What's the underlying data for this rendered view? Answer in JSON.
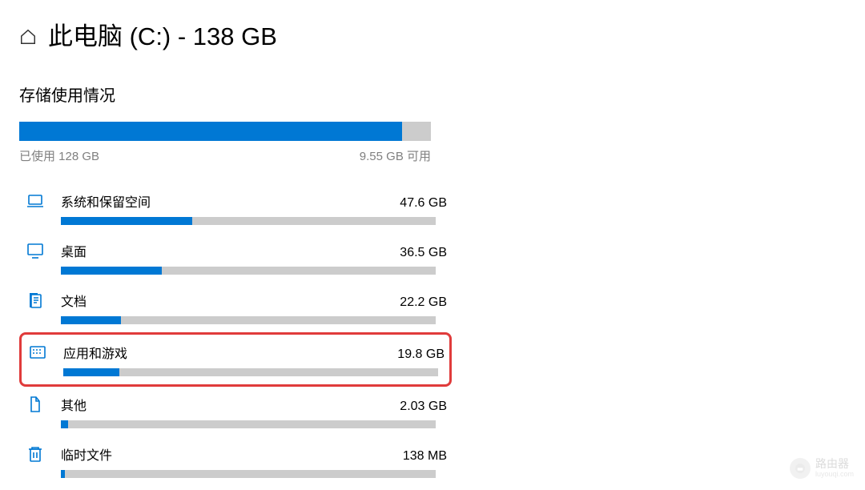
{
  "header": {
    "title": "此电脑 (C:) - 138 GB"
  },
  "section_title": "存储使用情况",
  "overview": {
    "used_label": "已使用 128 GB",
    "free_label": "9.55 GB 可用",
    "fill_percent": 93
  },
  "categories": [
    {
      "icon": "laptop-icon",
      "name": "系统和保留空间",
      "size": "47.6 GB",
      "fill_percent": 35,
      "highlighted": false
    },
    {
      "icon": "monitor-icon",
      "name": "桌面",
      "size": "36.5 GB",
      "fill_percent": 27,
      "highlighted": false
    },
    {
      "icon": "document-icon",
      "name": "文档",
      "size": "22.2 GB",
      "fill_percent": 16,
      "highlighted": false
    },
    {
      "icon": "apps-icon",
      "name": "应用和游戏",
      "size": "19.8 GB",
      "fill_percent": 15,
      "highlighted": true
    },
    {
      "icon": "package-icon",
      "name": "其他",
      "size": "2.03 GB",
      "fill_percent": 2,
      "highlighted": false
    },
    {
      "icon": "trash-icon",
      "name": "临时文件",
      "size": "138 MB",
      "fill_percent": 1,
      "highlighted": false
    }
  ],
  "watermark": {
    "text": "路由器",
    "sub": "luyouqi.com"
  },
  "chart_data": {
    "type": "bar",
    "title": "存储使用情况 — 此电脑 (C:) - 138 GB",
    "total_gb": 138,
    "used_gb": 128,
    "free_gb": 9.55,
    "series": [
      {
        "name": "系统和保留空间",
        "value_gb": 47.6
      },
      {
        "name": "桌面",
        "value_gb": 36.5
      },
      {
        "name": "文档",
        "value_gb": 22.2
      },
      {
        "name": "应用和游戏",
        "value_gb": 19.8
      },
      {
        "name": "其他",
        "value_gb": 2.03
      },
      {
        "name": "临时文件",
        "value_gb": 0.138
      }
    ],
    "xlabel": "GB",
    "ylim": [
      0,
      138
    ]
  }
}
